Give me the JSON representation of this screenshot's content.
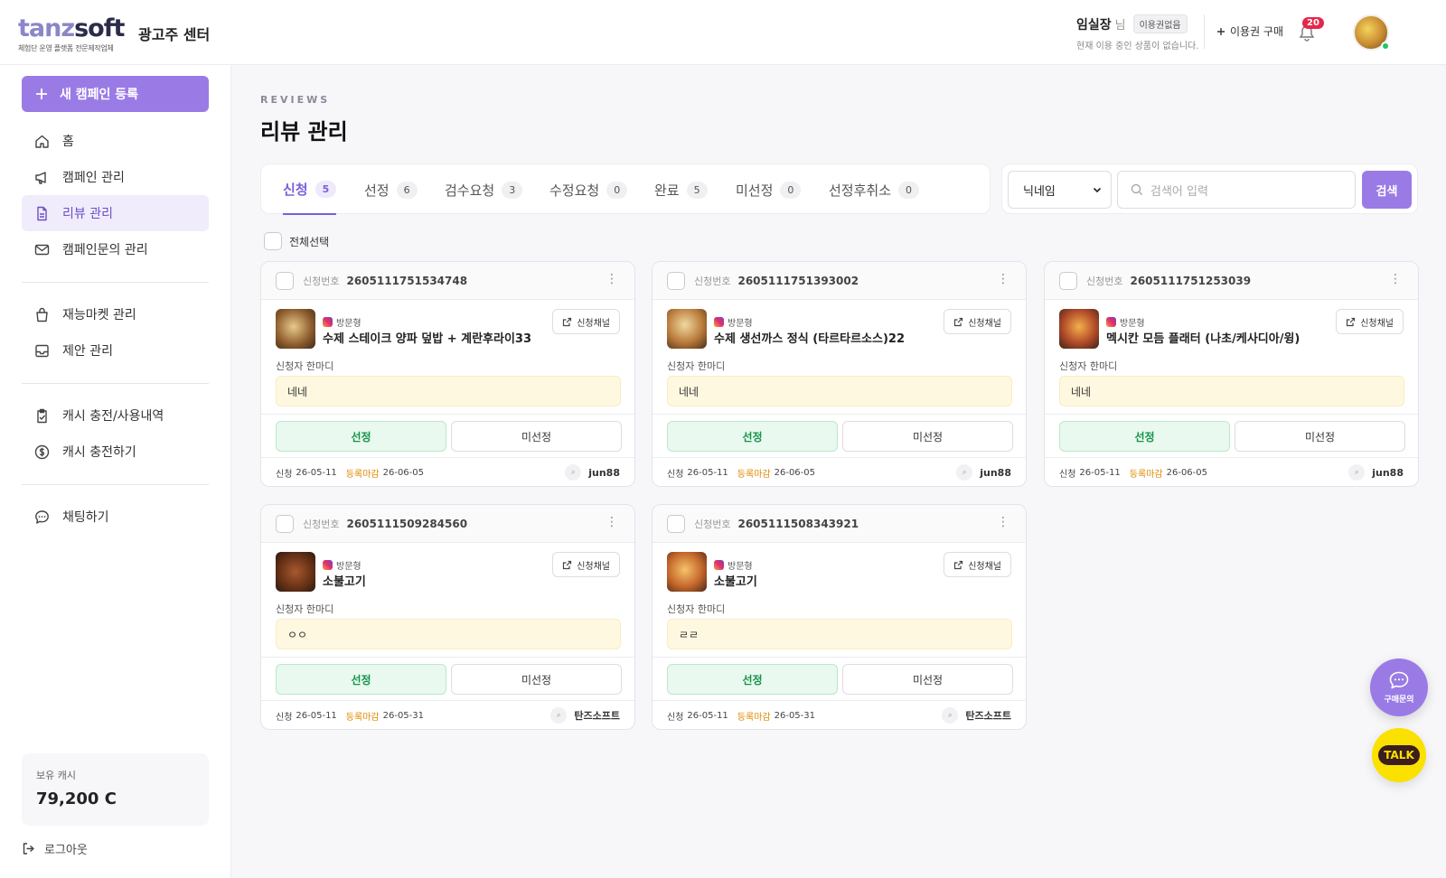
{
  "header": {
    "logo_part1": "tanz",
    "logo_part2": "soft",
    "logo_sub": "체험단 운영 플랫폼 전문제작업체",
    "center_name": "광고주 센터",
    "user_name": "임실장",
    "user_suffix": "님",
    "plan_badge": "이용권없음",
    "user_desc": "현재 이용 중인 상품이 없습니다.",
    "buy_label": "이용권 구매",
    "notif_count": "20"
  },
  "sidebar": {
    "new_campaign": "새 캠페인 등록",
    "items": [
      {
        "label": "홈"
      },
      {
        "label": "캠페인 관리"
      },
      {
        "label": "리뷰 관리"
      },
      {
        "label": "캠페인문의 관리"
      },
      {
        "label": "재능마켓 관리"
      },
      {
        "label": "제안 관리"
      },
      {
        "label": "캐시 충전/사용내역"
      },
      {
        "label": "캐시 충전하기"
      },
      {
        "label": "채팅하기"
      }
    ],
    "cash_label": "보유 캐시",
    "cash_value": "79,200 C",
    "logout": "로그아웃"
  },
  "main": {
    "eyebrow": "REVIEWS",
    "title": "리뷰 관리",
    "tabs": [
      {
        "label": "신청",
        "count": "5"
      },
      {
        "label": "선정",
        "count": "6"
      },
      {
        "label": "검수요청",
        "count": "3"
      },
      {
        "label": "수정요청",
        "count": "0"
      },
      {
        "label": "완료",
        "count": "5"
      },
      {
        "label": "미선정",
        "count": "0"
      },
      {
        "label": "선정후취소",
        "count": "0"
      }
    ],
    "search": {
      "select_value": "닉네임",
      "placeholder": "검색어 입력",
      "button": "검색"
    },
    "select_all": "전체선택"
  },
  "card_labels": {
    "app_no": "신청번호",
    "type": "방문형",
    "channel": "신청채널",
    "comment": "신청자 한마디",
    "select": "선정",
    "unselect": "미선정",
    "applied": "신청",
    "deadline": "등록마감"
  },
  "cards": [
    {
      "app_no": "2605111751534748",
      "title": "수제 스테이크 양파 덮밥 + 계란후라이33",
      "comment": "네네",
      "applied": "26-05-11",
      "deadline": "26-06-05",
      "user": "jun88"
    },
    {
      "app_no": "2605111751393002",
      "title": "수제 생선까스 정식 (타르타르소스)22",
      "comment": "네네",
      "applied": "26-05-11",
      "deadline": "26-06-05",
      "user": "jun88"
    },
    {
      "app_no": "2605111751253039",
      "title": "멕시칸 모듬 플래터 (나초/케사디아/윙)",
      "comment": "네네",
      "applied": "26-05-11",
      "deadline": "26-06-05",
      "user": "jun88"
    },
    {
      "app_no": "2605111509284560",
      "title": "소불고기",
      "comment": "ㅇㅇ",
      "applied": "26-05-11",
      "deadline": "26-05-31",
      "user": "탄즈소프트"
    },
    {
      "app_no": "2605111508343921",
      "title": "소불고기",
      "comment": "ㄹㄹ",
      "applied": "26-05-11",
      "deadline": "26-05-31",
      "user": "탄즈소프트"
    }
  ],
  "floating": {
    "inquiry": "구매문의",
    "talk": "TALK"
  },
  "colors": {
    "accent": "#9a7be6",
    "selected_green": "#15924a",
    "deadline_orange": "#e08a00",
    "badge_red": "#e5274a"
  }
}
